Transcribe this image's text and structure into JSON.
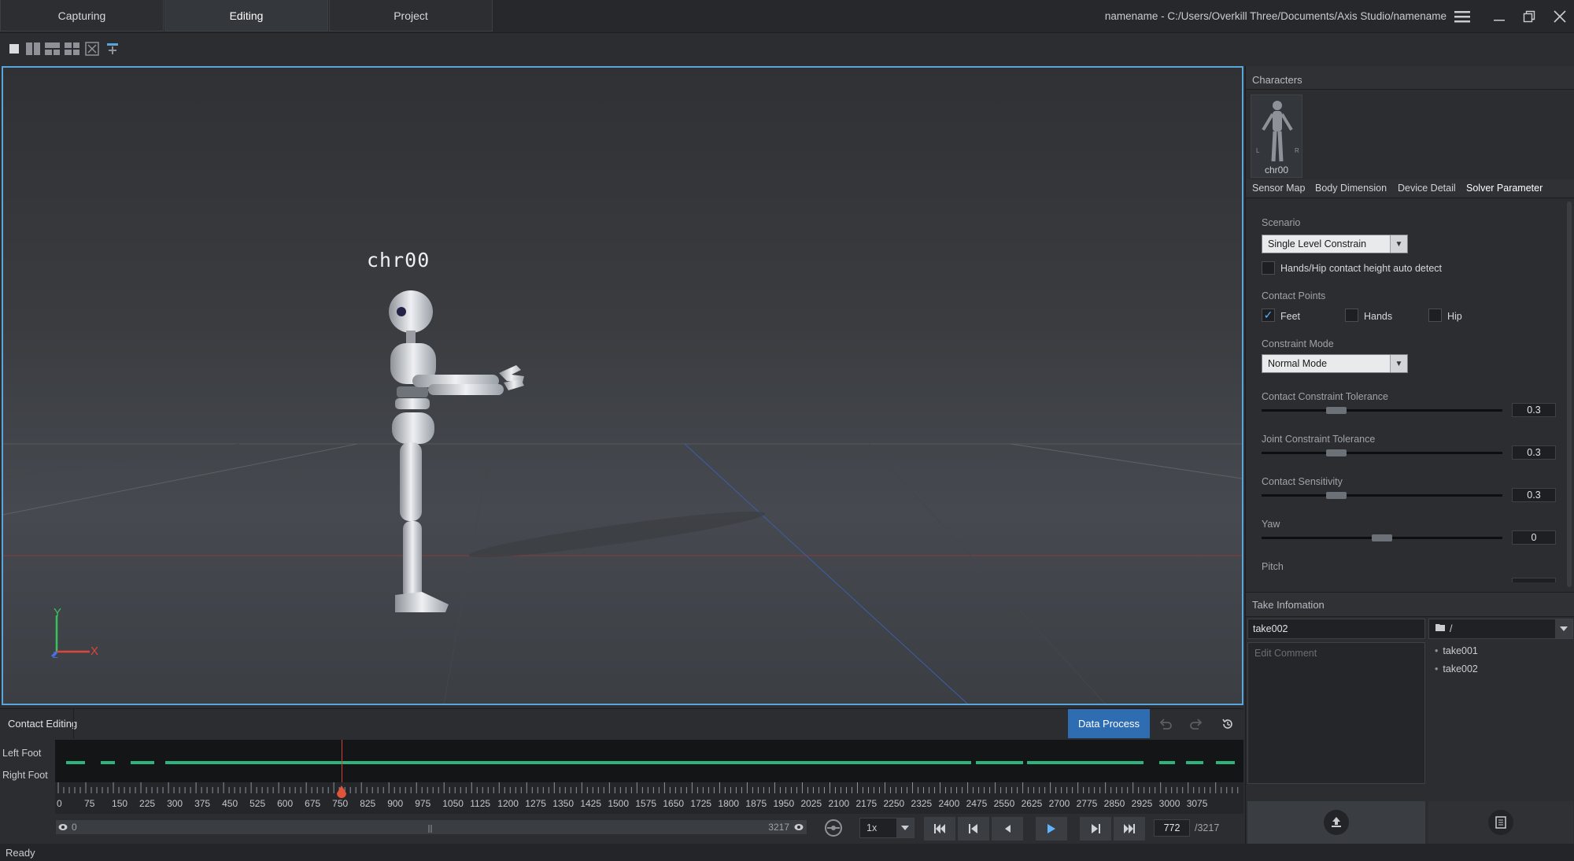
{
  "titlebar": {
    "tabs": [
      {
        "label": "Capturing",
        "active": false
      },
      {
        "label": "Editing",
        "active": true
      },
      {
        "label": "Project",
        "active": false
      }
    ],
    "window_path": "namename - C:/Users/Overkill Three/Documents/Axis Studio/namename",
    "icons": [
      "hamburger-menu-icon",
      "minimize-icon",
      "restore-icon",
      "close-icon"
    ]
  },
  "layout_toolbar": {
    "icons": [
      "layout-single-icon",
      "layout-two-columns-icon",
      "layout-three-icon",
      "layout-quad-icon",
      "layout-custom-icon",
      "layout-add-icon"
    ]
  },
  "viewport": {
    "character_label": "chr00",
    "axes": {
      "y": "Y",
      "x": "X",
      "z": "Z"
    }
  },
  "contact_editing": {
    "title": "Contact Editing",
    "data_process_label": "Data Process",
    "track_labels": [
      "Left Foot",
      "Right Foot"
    ],
    "ticks": [
      "0",
      "75",
      "150",
      "225",
      "300",
      "375",
      "450",
      "525",
      "600",
      "675",
      "750",
      "825",
      "900",
      "975",
      "1050",
      "1125",
      "1200",
      "1275",
      "1350",
      "1425",
      "1500",
      "1575",
      "1650",
      "1725",
      "1800",
      "1875",
      "1950",
      "2025",
      "2100",
      "2175",
      "2250",
      "2325",
      "2400",
      "2475",
      "2550",
      "2625",
      "2700",
      "2775",
      "2850",
      "2925",
      "3000",
      "3075"
    ],
    "playhead_frame": 772,
    "total_frames": 3217,
    "accent_green": "#2fb37d",
    "accent_purple": "#7d5fb8"
  },
  "timeline_controls": {
    "range_start": "0",
    "range_end": "3217",
    "speed": "1x",
    "current_frame": "772",
    "total_label": "/3217"
  },
  "status": "Ready",
  "right_panel": {
    "characters_title": "Characters",
    "character_name": "chr00",
    "figure_marks": {
      "left": "L",
      "right": "R"
    },
    "subtabs": [
      "Sensor Map",
      "Body Dimension",
      "Device Detail",
      "Solver Parameter"
    ],
    "solver": {
      "scenario_label": "Scenario",
      "scenario_value": "Single Level Constrain",
      "auto_detect_label": "Hands/Hip contact height auto detect",
      "auto_detect_checked": false,
      "contact_points_label": "Contact Points",
      "contact_points": [
        {
          "label": "Feet",
          "checked": true
        },
        {
          "label": "Hands",
          "checked": false
        },
        {
          "label": "Hip",
          "checked": false
        }
      ],
      "constraint_mode_label": "Constraint Mode",
      "constraint_mode_value": "Normal Mode",
      "sliders": [
        {
          "label": "Contact Constraint Tolerance",
          "value": "0.3"
        },
        {
          "label": "Joint Constraint Tolerance",
          "value": "0.3"
        },
        {
          "label": "Contact Sensitivity",
          "value": "0.3"
        },
        {
          "label": "Yaw",
          "value": "0"
        }
      ],
      "pitch_label": "Pitch"
    },
    "take_info": {
      "title": "Take Infomation",
      "take_name": "take002",
      "folder_path": "/",
      "comment_placeholder": "Edit Comment",
      "takes": [
        "take001",
        "take002"
      ]
    }
  }
}
